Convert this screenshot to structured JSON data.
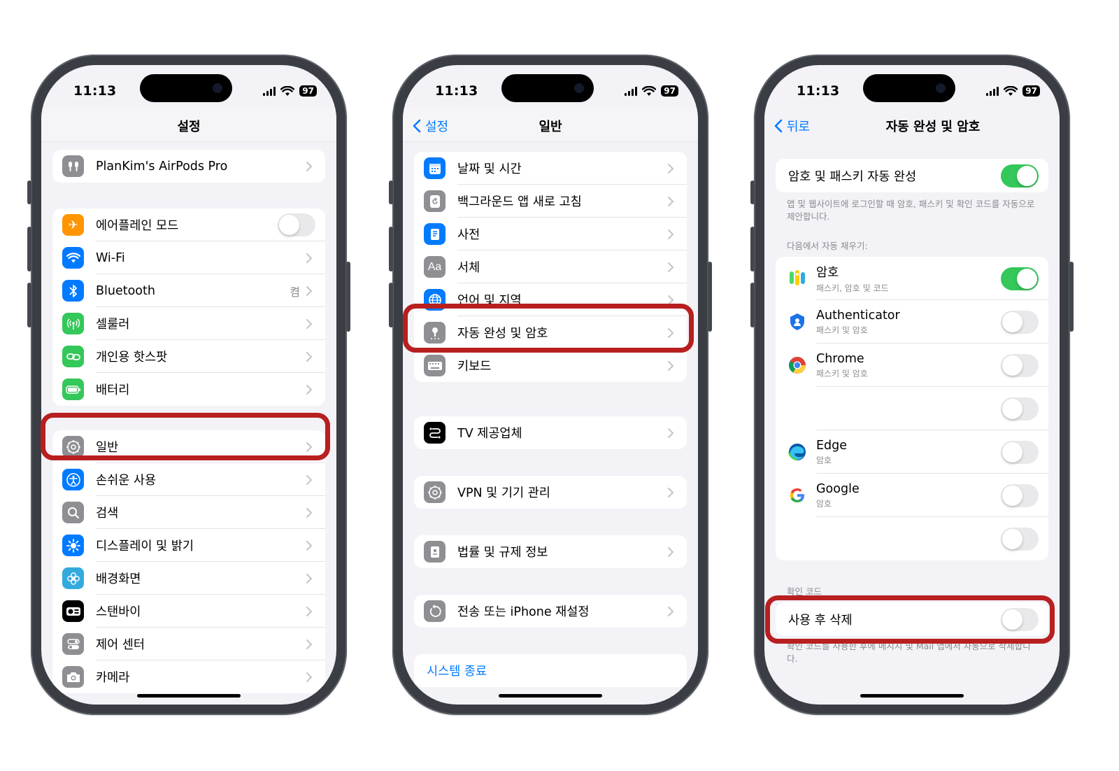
{
  "phone1": {
    "time": "11:13",
    "battery": "97",
    "title": "설정",
    "airpods_label": "PlanKim's AirPods Pro",
    "group2": [
      {
        "label": "에어플레인 모드",
        "icon": "airplane-icon",
        "color": "#ff9500",
        "toggle": false
      },
      {
        "label": "Wi-Fi",
        "icon": "wifi-icon",
        "color": "#007aff"
      },
      {
        "label": "Bluetooth",
        "icon": "bluetooth-icon",
        "color": "#007aff",
        "value": "켬"
      },
      {
        "label": "셀룰러",
        "icon": "cellular-icon",
        "color": "#34c759"
      },
      {
        "label": "개인용 핫스팟",
        "icon": "hotspot-icon",
        "color": "#34c759"
      },
      {
        "label": "배터리",
        "icon": "battery-icon",
        "color": "#34c759"
      }
    ],
    "group3": [
      {
        "label": "일반",
        "icon": "gear-icon",
        "color": "#8e8e93"
      },
      {
        "label": "손쉬운 사용",
        "icon": "accessibility-icon",
        "color": "#007aff"
      },
      {
        "label": "검색",
        "icon": "search-icon",
        "color": "#8e8e93"
      },
      {
        "label": "디스플레이 및 밝기",
        "icon": "brightness-icon",
        "color": "#007aff"
      },
      {
        "label": "배경화면",
        "icon": "flower-icon",
        "color": "#34aadc"
      },
      {
        "label": "스탠바이",
        "icon": "standby-icon",
        "color": "#000000"
      },
      {
        "label": "제어 센터",
        "icon": "control-center-icon",
        "color": "#8e8e93"
      },
      {
        "label": "카메라",
        "icon": "camera-icon",
        "color": "#8e8e93"
      }
    ]
  },
  "phone2": {
    "time": "11:13",
    "battery": "97",
    "back": "설정",
    "title": "일반",
    "group1": [
      {
        "label": "날짜 및 시간",
        "icon": "calendar-icon",
        "color": "#007aff"
      },
      {
        "label": "백그라운드 앱 새로 고침",
        "icon": "refresh-icon",
        "color": "#8e8e93"
      },
      {
        "label": "사전",
        "icon": "dictionary-icon",
        "color": "#007aff"
      },
      {
        "label": "서체",
        "icon": "font-icon",
        "color": "#8e8e93"
      },
      {
        "label": "언어 및 지역",
        "icon": "globe-icon",
        "color": "#007aff"
      },
      {
        "label": "자동 완성 및 암호",
        "icon": "key-icon",
        "color": "#8e8e93"
      },
      {
        "label": "키보드",
        "icon": "keyboard-icon",
        "color": "#8e8e93"
      }
    ],
    "tv_provider": "TV 제공업체",
    "vpn": "VPN 및 기기 관리",
    "legal": "법률 및 규제 정보",
    "transfer": "전송 또는 iPhone 재설정",
    "shutdown": "시스템 종료"
  },
  "phone3": {
    "time": "11:13",
    "battery": "97",
    "back": "뒤로",
    "title": "자동 완성 및 암호",
    "autofill_label": "암호 및 패스키 자동 완성",
    "autofill_caption": "앱 및 웹사이트에 로그인할 때 암호, 패스키 및 확인 코드를 자동으로 제안합니다.",
    "fill_from_header": "다음에서 자동 채우기:",
    "apps": [
      {
        "name": "암호",
        "sub": "패스키, 암호 및 코드",
        "icon": "passwords-app-icon",
        "on": true
      },
      {
        "name": "Authenticator",
        "sub": "패스키 및 암호",
        "icon": "authenticator-icon",
        "on": false
      },
      {
        "name": "Chrome",
        "sub": "패스키 및 암호",
        "icon": "chrome-icon",
        "on": false
      },
      {
        "name": "",
        "sub": "",
        "icon": "blank-app-icon",
        "on": false
      },
      {
        "name": "Edge",
        "sub": "암호",
        "icon": "edge-icon",
        "on": false
      },
      {
        "name": "Google",
        "sub": "암호",
        "icon": "google-icon",
        "on": false
      },
      {
        "name": "",
        "sub": "",
        "icon": "blank-app-icon",
        "on": false
      }
    ],
    "verify_header": "확인 코드",
    "delete_label": "사용 후 삭제",
    "delete_caption": "확인 코드를 사용한 후에 메시지 및 Mail 앱에서 자동으로 삭제합니다."
  },
  "colors": {
    "highlight": "#b81f1f",
    "toggle_on": "#34c759",
    "link": "#007aff"
  }
}
